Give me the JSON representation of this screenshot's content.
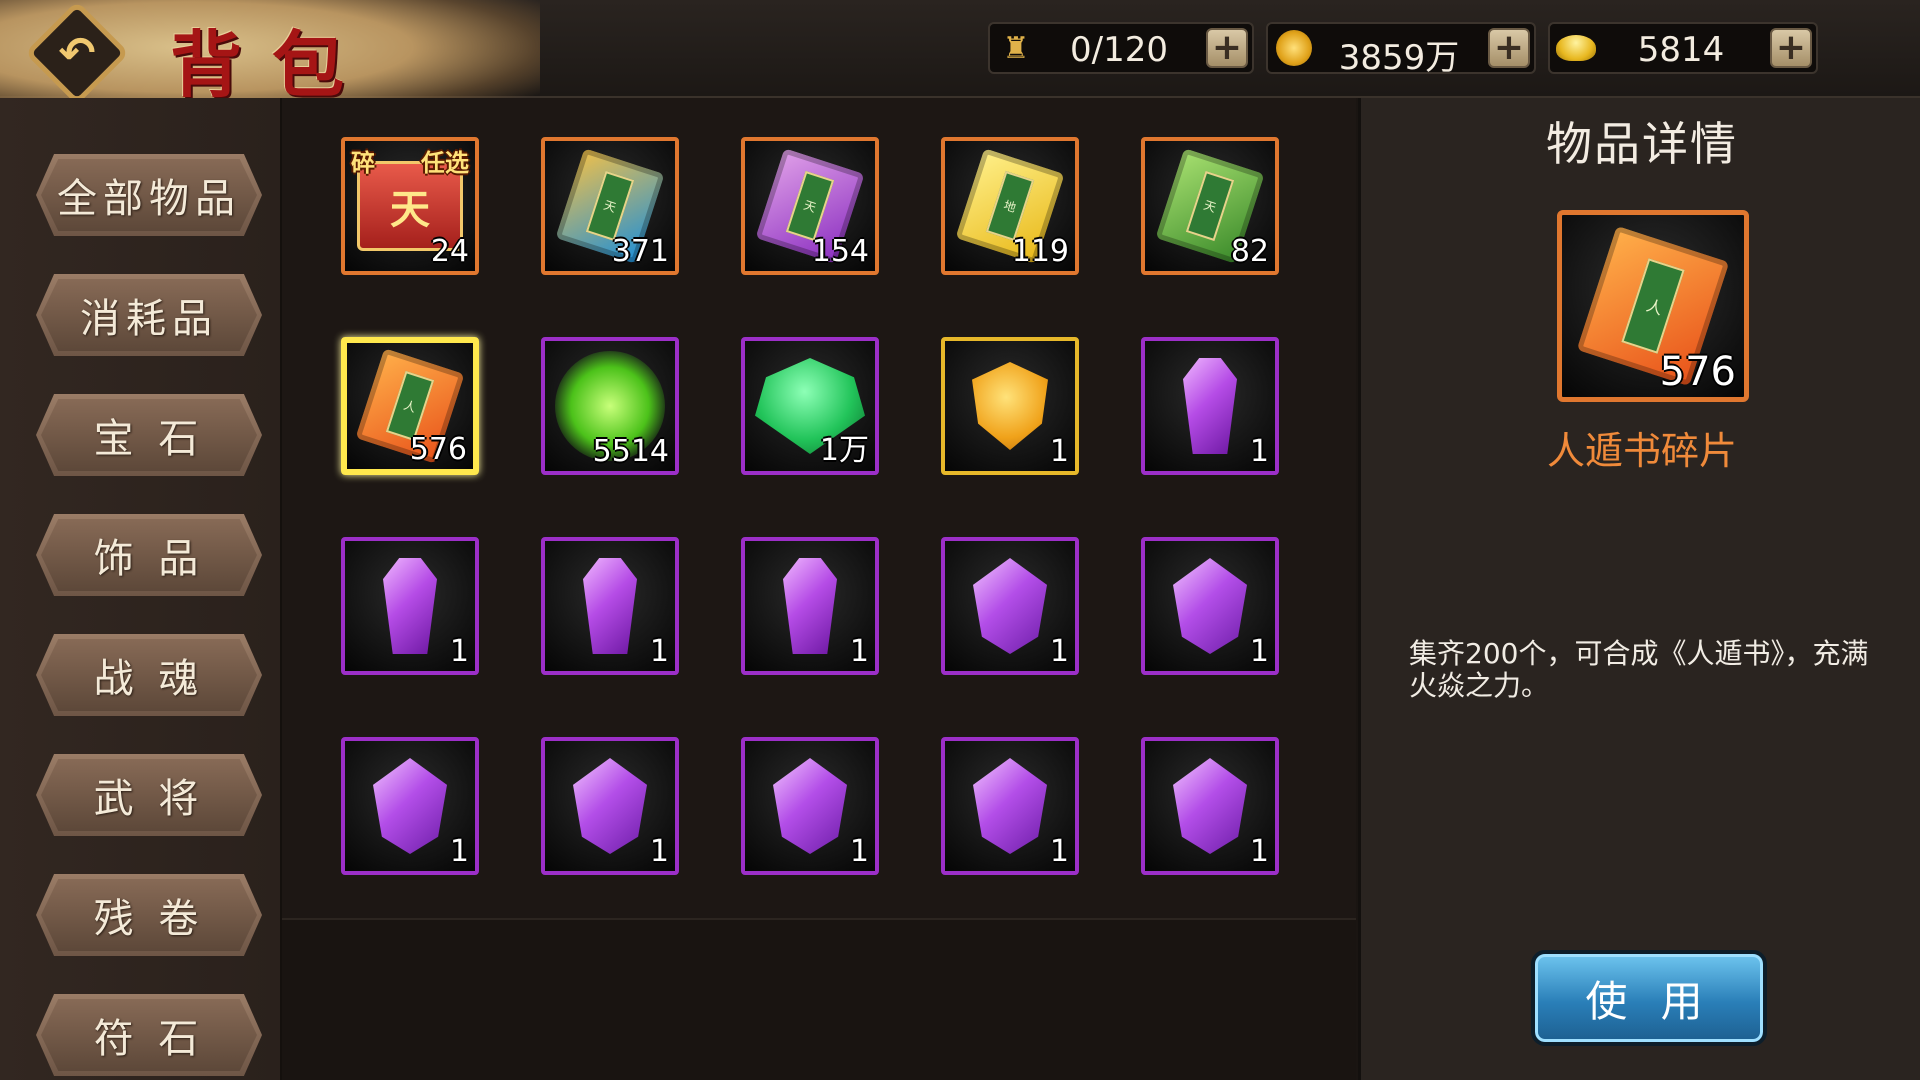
{
  "header": {
    "title": "背包",
    "back_icon": "back-arrow-icon"
  },
  "currencies": [
    {
      "icon": "torch-icon",
      "value": "0/120"
    },
    {
      "icon": "coin-icon",
      "value": "3859万"
    },
    {
      "icon": "ingot-icon",
      "value": "5814"
    }
  ],
  "sidebar": {
    "tabs": [
      "全部物品",
      "消耗品",
      "宝 石",
      "饰 品",
      "战 魂",
      "武 将",
      "残 卷",
      "符 石"
    ]
  },
  "grid": {
    "items": [
      {
        "icon": "treasure-chest",
        "count": "24",
        "badge_left": "碎",
        "badge_right": "任选",
        "rarity": "orange"
      },
      {
        "icon": "blue-book-fragment",
        "count": "371",
        "rarity": "orange"
      },
      {
        "icon": "purple-book-fragment",
        "count": "154",
        "rarity": "orange"
      },
      {
        "icon": "gold-book-fragment",
        "count": "119",
        "rarity": "orange"
      },
      {
        "icon": "green-book-fragment",
        "count": "82",
        "rarity": "orange"
      },
      {
        "icon": "orange-book-fragment",
        "count": "576",
        "rarity": "selected"
      },
      {
        "icon": "green-orb",
        "count": "5514",
        "rarity": "purple"
      },
      {
        "icon": "green-jade",
        "count": "1万",
        "rarity": "purple"
      },
      {
        "icon": "gold-shield",
        "count": "1",
        "rarity": "gold"
      },
      {
        "icon": "purple-crystal",
        "count": "1",
        "rarity": "purple"
      },
      {
        "icon": "purple-crystal",
        "count": "1",
        "rarity": "purple"
      },
      {
        "icon": "purple-crystal",
        "count": "1",
        "rarity": "purple"
      },
      {
        "icon": "purple-crystal",
        "count": "1",
        "rarity": "purple"
      },
      {
        "icon": "purple-gem",
        "count": "1",
        "rarity": "purple"
      },
      {
        "icon": "purple-gem",
        "count": "1",
        "rarity": "purple"
      },
      {
        "icon": "purple-gem",
        "count": "1",
        "rarity": "purple"
      },
      {
        "icon": "purple-gem",
        "count": "1",
        "rarity": "purple"
      },
      {
        "icon": "purple-gem",
        "count": "1",
        "rarity": "purple"
      },
      {
        "icon": "purple-gem",
        "count": "1",
        "rarity": "purple"
      },
      {
        "icon": "purple-gem",
        "count": "1",
        "rarity": "purple"
      }
    ]
  },
  "detail": {
    "title": "物品详情",
    "item_icon": "orange-book-fragment",
    "count": "576",
    "name": "人遁书碎片",
    "description": "集齐200个，可合成《人遁书》，充满火焱之力。",
    "use_label": "使 用"
  },
  "colors": {
    "orange_border": "#e0772f",
    "purple_border": "#9c2fc8",
    "gold_border": "#e7b82a",
    "selected_border": "#ffe84d",
    "title_red": "#a51515",
    "item_name": "#f08a3a",
    "use_button": "#2a7fb8"
  }
}
